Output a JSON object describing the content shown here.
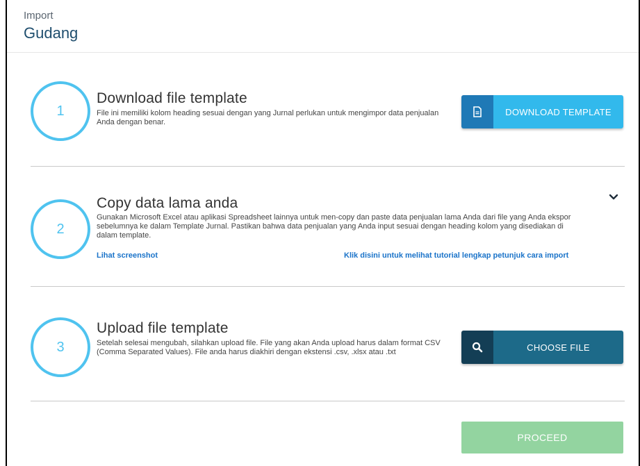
{
  "header": {
    "subtitle": "Import",
    "title": "Gudang"
  },
  "steps": [
    {
      "number": "1",
      "title": "Download file template",
      "description": "File ini memiliki kolom heading sesuai dengan yang Jurnal perlukan untuk mengimpor data penjualan Anda dengan benar.",
      "button_label": "DOWNLOAD TEMPLATE",
      "button_icon": "document-icon"
    },
    {
      "number": "2",
      "title": "Copy data lama anda",
      "description": "Gunakan Microsoft Excel atau aplikasi Spreadsheet lainnya untuk men-copy dan paste data penjualan lama Anda dari file yang Anda ekspor sebelumnya ke dalam Template Jurnal. Pastikan bahwa data penjualan yang Anda input sesuai dengan heading kolom yang disediakan di dalam template.",
      "link_screenshot": "Lihat screenshot",
      "link_tutorial": "Klik disini untuk melihat tutorial lengkap petunjuk cara import",
      "toggle_icon": "chevron-down-icon"
    },
    {
      "number": "3",
      "title": "Upload file template",
      "description": "Setelah selesai mengubah, silahkan upload file. File yang akan Anda upload harus dalam format CSV (Comma Separated Values). File anda harus diakhiri dengan ekstensi .csv, .xlsx atau .txt",
      "button_label": "CHOOSE FILE",
      "button_icon": "search-icon"
    }
  ],
  "footer": {
    "proceed_label": "PROCEED"
  },
  "colors": {
    "accent_circle": "#4fc3ef",
    "download_button": "#32b9ec",
    "choose_button": "#1d6a89",
    "proceed_button": "#93d4a0",
    "link": "#1a73c9",
    "title": "#1f4e6e"
  }
}
